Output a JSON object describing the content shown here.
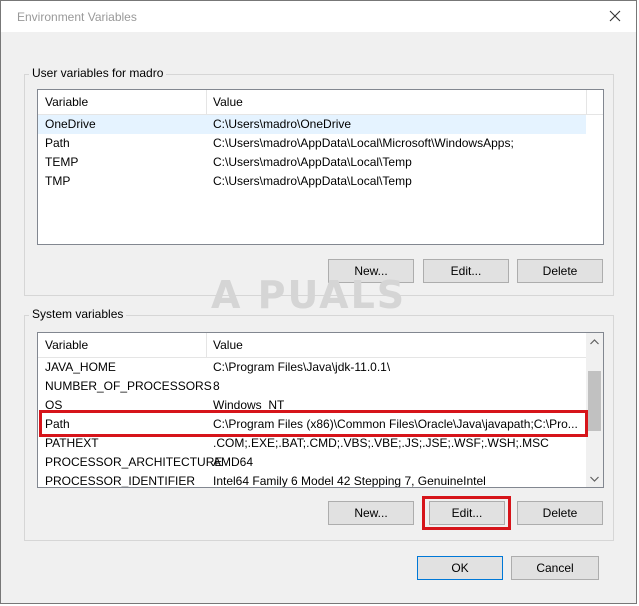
{
  "window": {
    "title": "Environment Variables"
  },
  "user_vars": {
    "legend": "User variables for madro",
    "headers": {
      "variable": "Variable",
      "value": "Value"
    },
    "rows": [
      {
        "variable": "OneDrive",
        "value": "C:\\Users\\madro\\OneDrive"
      },
      {
        "variable": "Path",
        "value": "C:\\Users\\madro\\AppData\\Local\\Microsoft\\WindowsApps;"
      },
      {
        "variable": "TEMP",
        "value": "C:\\Users\\madro\\AppData\\Local\\Temp"
      },
      {
        "variable": "TMP",
        "value": "C:\\Users\\madro\\AppData\\Local\\Temp"
      }
    ],
    "buttons": {
      "new": "New...",
      "edit": "Edit...",
      "delete": "Delete"
    }
  },
  "system_vars": {
    "legend": "System variables",
    "headers": {
      "variable": "Variable",
      "value": "Value"
    },
    "rows": [
      {
        "variable": "JAVA_HOME",
        "value": "C:\\Program Files\\Java\\jdk-11.0.1\\"
      },
      {
        "variable": "NUMBER_OF_PROCESSORS",
        "value": "8"
      },
      {
        "variable": "OS",
        "value": "Windows_NT"
      },
      {
        "variable": "Path",
        "value": "C:\\Program Files (x86)\\Common Files\\Oracle\\Java\\javapath;C:\\Pro..."
      },
      {
        "variable": "PATHEXT",
        "value": ".COM;.EXE;.BAT;.CMD;.VBS;.VBE;.JS;.JSE;.WSF;.WSH;.MSC"
      },
      {
        "variable": "PROCESSOR_ARCHITECTURE",
        "value": "AMD64"
      },
      {
        "variable": "PROCESSOR_IDENTIFIER",
        "value": "Intel64 Family 6 Model 42 Stepping 7, GenuineIntel"
      }
    ],
    "buttons": {
      "new": "New...",
      "edit": "Edit...",
      "delete": "Delete"
    }
  },
  "footer": {
    "ok": "OK",
    "cancel": "Cancel"
  },
  "watermark": "A  PUALS",
  "colors": {
    "highlight": "#d6141a",
    "selection": "#e5f3ff"
  }
}
